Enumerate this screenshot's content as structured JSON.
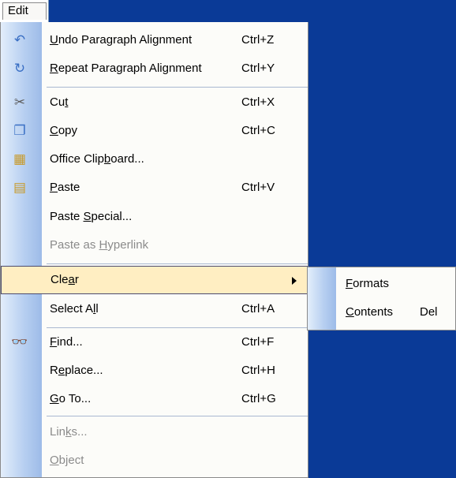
{
  "menubar": {
    "edit_label": "Edit"
  },
  "menu": {
    "items": [
      {
        "name": "undo",
        "pre": "",
        "mn": "U",
        "post": "ndo Paragraph Alignment",
        "shortcut": "Ctrl+Z",
        "icon": "undo-icon",
        "glyph": "↶",
        "color": "#3a6fc4",
        "disabled": false
      },
      {
        "name": "repeat",
        "pre": "",
        "mn": "R",
        "post": "epeat Paragraph Alignment",
        "shortcut": "Ctrl+Y",
        "icon": "redo-icon",
        "glyph": "↻",
        "color": "#3a6fc4",
        "disabled": false
      },
      {
        "name": "cut",
        "pre": "Cu",
        "mn": "t",
        "post": "",
        "shortcut": "Ctrl+X",
        "icon": "scissors-icon",
        "glyph": "✂",
        "color": "#5d5d5d",
        "disabled": false
      },
      {
        "name": "copy",
        "pre": "",
        "mn": "C",
        "post": "opy",
        "shortcut": "Ctrl+C",
        "icon": "copy-icon",
        "glyph": "❐",
        "color": "#3a6fc4",
        "disabled": false
      },
      {
        "name": "office-clipboard",
        "pre": "Office Clip",
        "mn": "b",
        "post": "oard...",
        "shortcut": "",
        "icon": "clipboard-icon",
        "glyph": "▦",
        "color": "#c89a2a",
        "disabled": false
      },
      {
        "name": "paste",
        "pre": "",
        "mn": "P",
        "post": "aste",
        "shortcut": "Ctrl+V",
        "icon": "paste-icon",
        "glyph": "▤",
        "color": "#c89a2a",
        "disabled": false
      },
      {
        "name": "paste-special",
        "pre": "Paste ",
        "mn": "S",
        "post": "pecial...",
        "shortcut": "",
        "icon": "",
        "glyph": "",
        "color": "",
        "disabled": false
      },
      {
        "name": "paste-as-hyperlink",
        "pre": "Paste as ",
        "mn": "H",
        "post": "yperlink",
        "shortcut": "",
        "icon": "",
        "glyph": "",
        "color": "",
        "disabled": true
      },
      {
        "name": "clear",
        "pre": "Cle",
        "mn": "a",
        "post": "r",
        "shortcut": "",
        "icon": "",
        "glyph": "",
        "color": "",
        "disabled": false
      },
      {
        "name": "select-all",
        "pre": "Select A",
        "mn": "l",
        "post": "l",
        "shortcut": "Ctrl+A",
        "icon": "",
        "glyph": "",
        "color": "",
        "disabled": false
      },
      {
        "name": "find",
        "pre": "",
        "mn": "F",
        "post": "ind...",
        "shortcut": "Ctrl+F",
        "icon": "binoculars-icon",
        "glyph": "👓",
        "color": "#333",
        "disabled": false
      },
      {
        "name": "replace",
        "pre": "R",
        "mn": "e",
        "post": "place...",
        "shortcut": "Ctrl+H",
        "icon": "",
        "glyph": "",
        "color": "",
        "disabled": false
      },
      {
        "name": "go-to",
        "pre": "",
        "mn": "G",
        "post": "o To...",
        "shortcut": "Ctrl+G",
        "icon": "",
        "glyph": "",
        "color": "",
        "disabled": false
      },
      {
        "name": "links",
        "pre": "Lin",
        "mn": "k",
        "post": "s...",
        "shortcut": "",
        "icon": "",
        "glyph": "",
        "color": "",
        "disabled": true
      },
      {
        "name": "object",
        "pre": "",
        "mn": "O",
        "post": "bject",
        "shortcut": "",
        "icon": "",
        "glyph": "",
        "color": "",
        "disabled": true
      }
    ]
  },
  "submenu": {
    "items": [
      {
        "name": "formats",
        "pre": "",
        "mn": "F",
        "post": "ormats",
        "shortcut": ""
      },
      {
        "name": "contents",
        "pre": "",
        "mn": "C",
        "post": "ontents",
        "shortcut": "Del"
      }
    ]
  },
  "colors": {
    "desktop": "#0a3a97",
    "highlight": "#ffeec2",
    "gutter": "#b8d0f1"
  }
}
